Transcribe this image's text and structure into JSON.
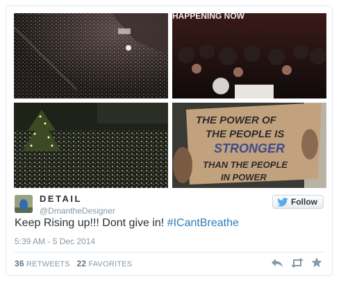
{
  "images": [
    {
      "name": "aerial-night-crowd"
    },
    {
      "name": "protest-crowd-street"
    },
    {
      "name": "crowd-at-christmas-tree"
    },
    {
      "name": "protest-sign"
    }
  ],
  "sign_text": [
    "THE POWER OF",
    "THE PEOPLE IS",
    "STRONGER",
    "THAN THE PEOPLE",
    "IN POWER"
  ],
  "top_banner_partial": "HAPPENING NOW",
  "user": {
    "name": "DETAIL",
    "handle": "@DmantheDesigner"
  },
  "follow_label": "Follow",
  "tweet": {
    "text_plain": "Keep Rising up!!! Dont give in! ",
    "hashtag": "#ICantBreathe",
    "timestamp": "5:39 AM - 5 Dec 2014"
  },
  "stats": {
    "retweets_count": "36",
    "retweets_label": "RETWEETS",
    "favorites_count": "22",
    "favorites_label": "FAVORITES"
  },
  "icons": {
    "follow": "twitter-bird-icon",
    "reply": "reply-icon",
    "retweet": "retweet-icon",
    "favorite": "star-icon"
  },
  "colors": {
    "hashtag": "#2b7bb9",
    "muted": "#8899a6",
    "twitter_blue": "#55acee"
  }
}
